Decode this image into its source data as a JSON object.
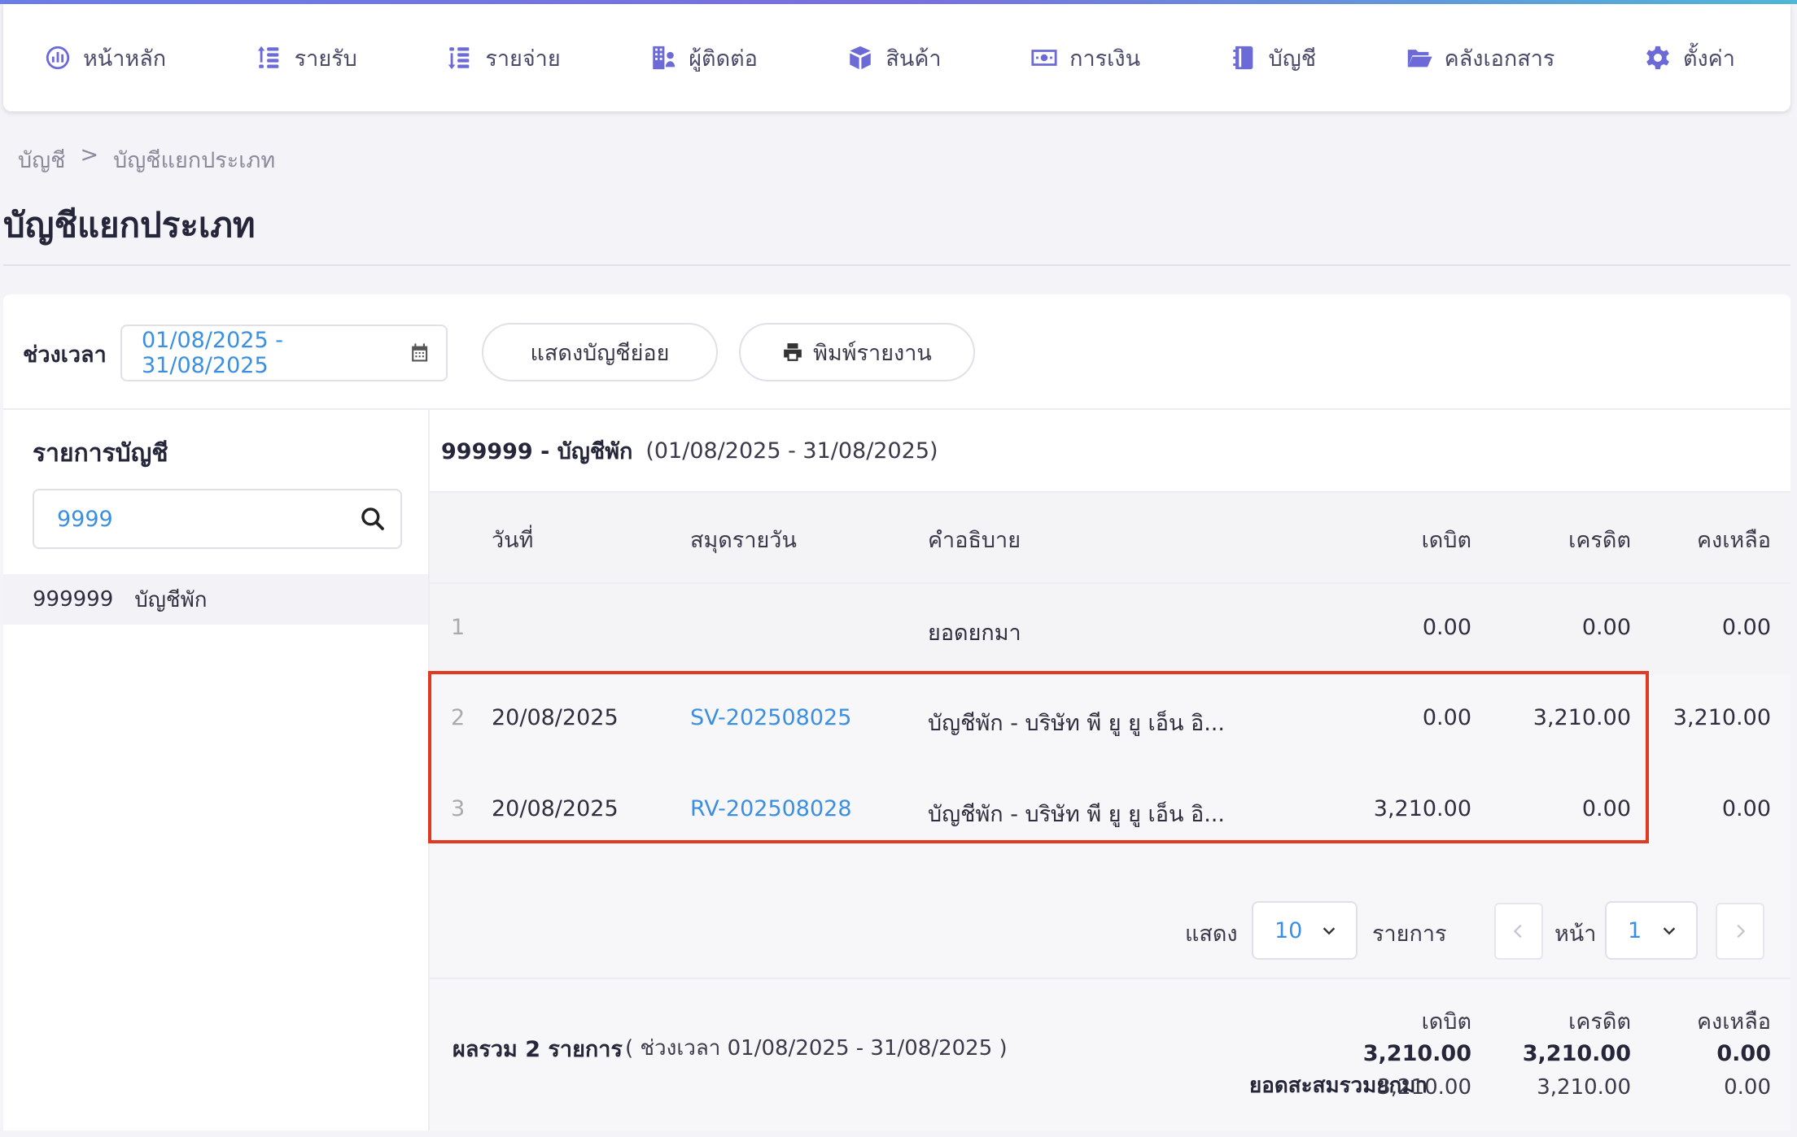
{
  "nav": {
    "items": [
      {
        "label": "หน้าหลัก",
        "icon": "dashboard-icon"
      },
      {
        "label": "รายรับ",
        "icon": "income-icon"
      },
      {
        "label": "รายจ่าย",
        "icon": "expense-icon"
      },
      {
        "label": "ผู้ติดต่อ",
        "icon": "contacts-icon"
      },
      {
        "label": "สินค้า",
        "icon": "box-icon"
      },
      {
        "label": "การเงิน",
        "icon": "money-icon"
      },
      {
        "label": "บัญชี",
        "icon": "ledger-book-icon"
      },
      {
        "label": "คลังเอกสาร",
        "icon": "folder-icon"
      },
      {
        "label": "ตั้งค่า",
        "icon": "gear-icon"
      }
    ]
  },
  "breadcrumb": {
    "root": "บัญชี",
    "sep": ">",
    "current": "บัญชีแยกประเภท"
  },
  "page_title": "บัญชีแยกประเภท",
  "filter": {
    "period_label": "ช่วงเวลา",
    "date_range": "01/08/2025 - 31/08/2025",
    "show_sub_label": "แสดงบัญชีย่อย",
    "print_label": "พิมพ์รายงาน"
  },
  "account_list": {
    "title": "รายการบัญชี",
    "search_value": "9999",
    "items": [
      {
        "code": "999999",
        "name": "บัญชีพัก"
      }
    ]
  },
  "ledger": {
    "account": "999999 - บัญชีพัก",
    "period": "(01/08/2025 - 31/08/2025)",
    "columns": {
      "date": "วันที่",
      "journal": "สมุดรายวัน",
      "desc": "คำอธิบาย",
      "debit": "เดบิต",
      "credit": "เครดิต",
      "balance": "คงเหลือ"
    },
    "rows": [
      {
        "no": "1",
        "date": "",
        "journal": "",
        "desc": "ยอดยกมา",
        "debit": "0.00",
        "credit": "0.00",
        "balance": "0.00"
      },
      {
        "no": "2",
        "date": "20/08/2025",
        "journal": "SV-202508025",
        "desc": "บัญชีพัก - บริษัท พี ยู ยู เอ็น อิ...",
        "debit": "0.00",
        "credit": "3,210.00",
        "balance": "3,210.00"
      },
      {
        "no": "3",
        "date": "20/08/2025",
        "journal": "RV-202508028",
        "desc": "บัญชีพัก - บริษัท พี ยู ยู เอ็น อิ...",
        "debit": "3,210.00",
        "credit": "0.00",
        "balance": "0.00"
      }
    ]
  },
  "pager": {
    "show_label": "แสดง",
    "page_size": "10",
    "items_label": "รายการ",
    "page_label": "หน้า",
    "page": "1"
  },
  "summary": {
    "total_label": "ผลรวม 2 รายการ",
    "period_text": "( ช่วงเวลา 01/08/2025 - 31/08/2025 )",
    "cumulative_label": "ยอดสะสมรวมยกมา",
    "debit_label": "เดบิต",
    "credit_label": "เครดิต",
    "balance_label": "คงเหลือ",
    "total_debit": "3,210.00",
    "total_credit": "3,210.00",
    "total_balance": "0.00",
    "cum_debit": "3,210.00",
    "cum_credit": "3,210.00",
    "cum_balance": "0.00"
  },
  "colors": {
    "accent": "#6b6ad6",
    "link": "#3b8fe0",
    "highlight": "#e23a22"
  }
}
